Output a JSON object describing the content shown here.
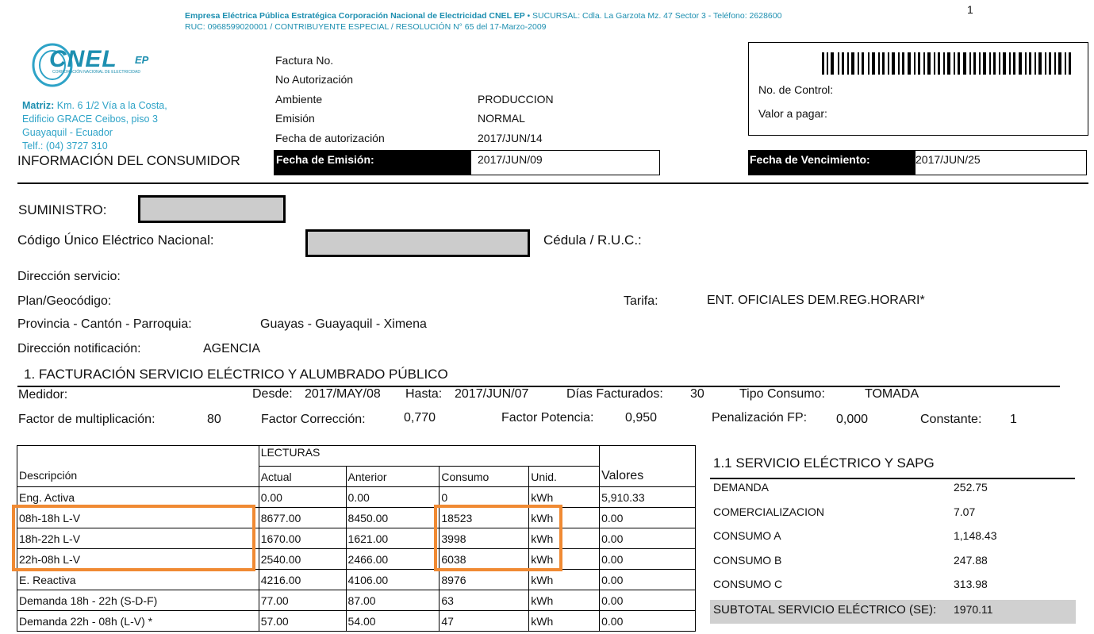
{
  "page_number": "1",
  "company": {
    "name_line": "Empresa Eléctrica Pública Estratégica Corporación Nacional de Electricidad CNEL EP",
    "sucursal": "• SUCURSAL: Cdla. La Garzota Mz. 47 Sector 3 - Teléfono: 2628600",
    "ruc_line": "RUC: 0968599020001 / CONTRIBUYENTE ESPECIAL / RESOLUCIÓN N° 65 del 17-Marzo-2009",
    "logo_text": "CNEL",
    "logo_ep": "EP",
    "logo_sub": "CORPORACIÓN NACIONAL DE ELECTRICIDAD",
    "matriz_label": "Matriz:",
    "matriz_line1": " Km. 6 1/2 Vía a la Costa,",
    "matriz_line2": "Edificio GRACE Ceibos, piso 3",
    "matriz_line3": "Guayaquil - Ecuador",
    "matriz_line4": "Telf.: (04) 3727 310",
    "brand_color": "#1d8fb0"
  },
  "invoice": {
    "factura_label": "Factura No.",
    "autorizacion_label": "No Autorización",
    "ambiente_label": "Ambiente",
    "ambiente_value": "PRODUCCION",
    "emision_label": "Emisión",
    "emision_value": "NORMAL",
    "fecha_aut_label": "Fecha de autorización",
    "fecha_aut_value": "2017/JUN/14",
    "fecha_emision_label": "Fecha de Emisión:",
    "fecha_emision_value": "2017/JUN/09",
    "fecha_venc_label": "Fecha de Vencimiento:",
    "fecha_venc_value": "2017/JUN/25",
    "control_label": "No. de Control:",
    "valor_label": "Valor a pagar:"
  },
  "consumer": {
    "section_title": "INFORMACIÓN DEL CONSUMIDOR",
    "suministro_label": "SUMINISTRO:",
    "codigo_label": "Código Único Eléctrico Nacional:",
    "cedula_label": "Cédula / R.U.C.:",
    "direccion_label": "Dirección servicio:",
    "plan_label": "Plan/Geocódigo:",
    "tarifa_label": "Tarifa:",
    "tarifa_value": "ENT. OFICIALES DEM.REG.HORARI*",
    "provincia_label": "Provincia - Cantón - Parroquia:",
    "provincia_value": "Guayas - Guayaquil - Ximena",
    "notificacion_label": "Dirección notificación:",
    "notificacion_value": "AGENCIA"
  },
  "billing": {
    "section_title": "1.  FACTURACIÓN SERVICIO ELÉCTRICO Y ALUMBRADO PÚBLICO",
    "medidor_label": "Medidor:",
    "desde_label": "Desde:",
    "desde_value": "2017/MAY/08",
    "hasta_label": "Hasta:",
    "hasta_value": "2017/JUN/07",
    "dias_label": "Días Facturados:",
    "dias_value": "30",
    "tipo_label": "Tipo Consumo:",
    "tipo_value": "TOMADA",
    "fm_label": "Factor de multiplicación:",
    "fm_value": "80",
    "fc_label": "Factor Corrección:",
    "fc_value": "0,770",
    "fp_label": "Factor Potencia:",
    "fp_value": "0,950",
    "pen_label": "Penalización FP:",
    "pen_value": "0,000",
    "const_label": "Constante:",
    "const_value": "1"
  },
  "readings": {
    "lecturas_label": "LECTURAS",
    "headers": [
      "Descripción",
      "Actual",
      "Anterior",
      "Consumo",
      "Unid.",
      "Valores"
    ],
    "rows": [
      [
        "Eng. Activa",
        "0.00",
        "0.00",
        "0",
        "kWh",
        "5,910.33"
      ],
      [
        "08h-18h L-V",
        "8677.00",
        "8450.00",
        "18523",
        "kWh",
        "0.00"
      ],
      [
        "18h-22h L-V",
        "1670.00",
        "1621.00",
        "3998",
        "kWh",
        "0.00"
      ],
      [
        "22h-08h L-V",
        "2540.00",
        "2466.00",
        "6038",
        "kWh",
        "0.00"
      ],
      [
        "E. Reactiva",
        "4216.00",
        "4106.00",
        "8976",
        "kWh",
        "0.00"
      ],
      [
        "Demanda 18h - 22h (S-D-F)",
        "77.00",
        "87.00",
        "63",
        "kWh",
        "0.00"
      ],
      [
        "Demanda 22h - 08h (L-V) *",
        "57.00",
        "54.00",
        "47",
        "kWh",
        "0.00"
      ]
    ],
    "highlight_color": "#f08a33"
  },
  "sapg": {
    "title": "1.1 SERVICIO ELÉCTRICO Y SAPG",
    "rows": [
      {
        "label": "DEMANDA",
        "value": "252.75"
      },
      {
        "label": "COMERCIALIZACION",
        "value": "7.07"
      },
      {
        "label": "CONSUMO A",
        "value": "1,148.43"
      },
      {
        "label": "CONSUMO B",
        "value": "247.88"
      },
      {
        "label": "CONSUMO C",
        "value": "313.98"
      }
    ],
    "subtotal_label": "SUBTOTAL SERVICIO ELÉCTRICO (SE):",
    "subtotal_value": "1970.11"
  }
}
